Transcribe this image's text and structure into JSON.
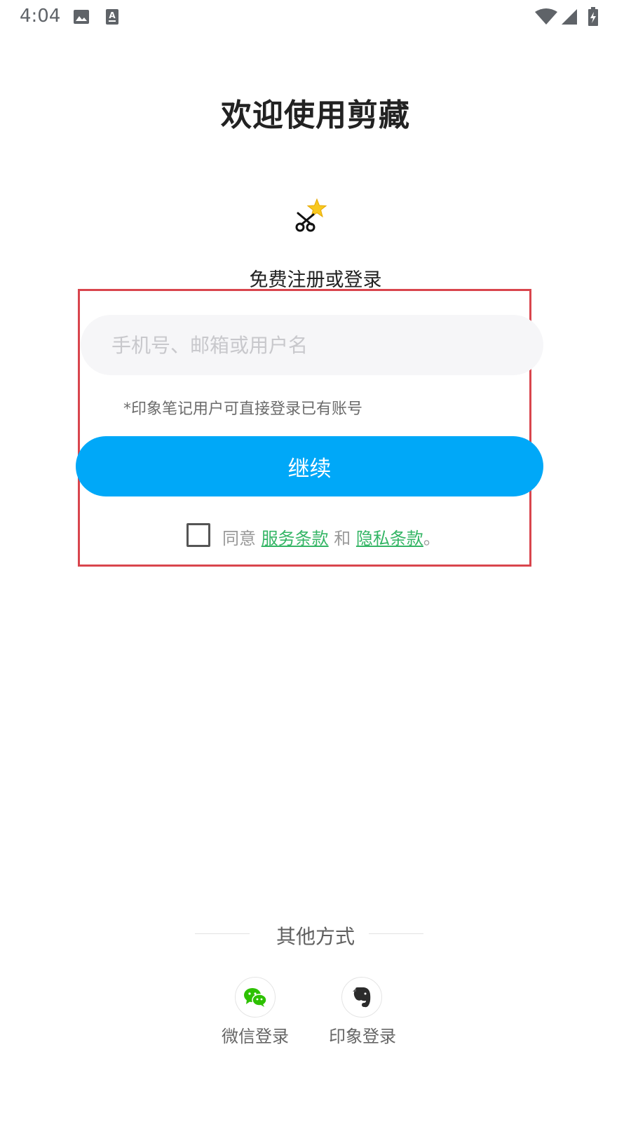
{
  "status_bar": {
    "time": "4:04"
  },
  "title": "欢迎使用剪藏",
  "subtitle": "免费注册或登录",
  "account_input": {
    "placeholder": "手机号、邮箱或用户名",
    "value": ""
  },
  "hint": "*印象笔记用户可直接登录已有账号",
  "continue_label": "继续",
  "agreement": {
    "checked": false,
    "prefix": "同意",
    "terms_link": "服务条款",
    "conjunction": "和",
    "privacy_link": "隐私条款",
    "suffix": "。"
  },
  "other_methods": {
    "label": "其他方式",
    "options": [
      {
        "label": "微信登录",
        "icon": "wechat-icon"
      },
      {
        "label": "印象登录",
        "icon": "evernote-icon"
      }
    ]
  },
  "colors": {
    "primary": "#00a8f8",
    "link": "#34b565",
    "highlight_border": "#d9454d",
    "wechat": "#2dc100",
    "star": "#f8c81f"
  }
}
